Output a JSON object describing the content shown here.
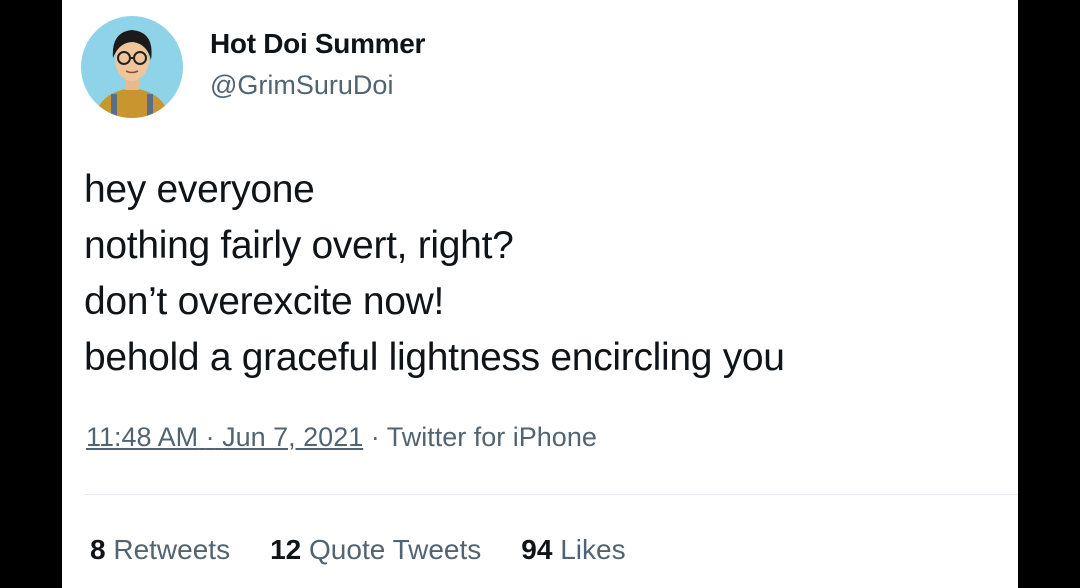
{
  "colors": {
    "page_background": "#000000",
    "card_background": "#ffffff",
    "primary_text": "#0f1419",
    "secondary_text": "#536471",
    "avatar_background": "#8fd3e8"
  },
  "author": {
    "display_name": "Hot Doi Summer",
    "handle": "@GrimSuruDoi",
    "avatar_icon": "user-avatar"
  },
  "tweet": {
    "lines": [
      "hey everyone",
      "nothing fairly overt, right?",
      "don’t overexcite now!",
      "behold a graceful lightness encircling you"
    ],
    "time": "11:48 AM",
    "separator": "·",
    "date": "Jun 7, 2021",
    "source": "Twitter for iPhone"
  },
  "stats": {
    "retweets_count": "8",
    "retweets_label": "Retweets",
    "quote_count": "12",
    "quote_label": "Quote Tweets",
    "likes_count": "94",
    "likes_label": "Likes"
  }
}
